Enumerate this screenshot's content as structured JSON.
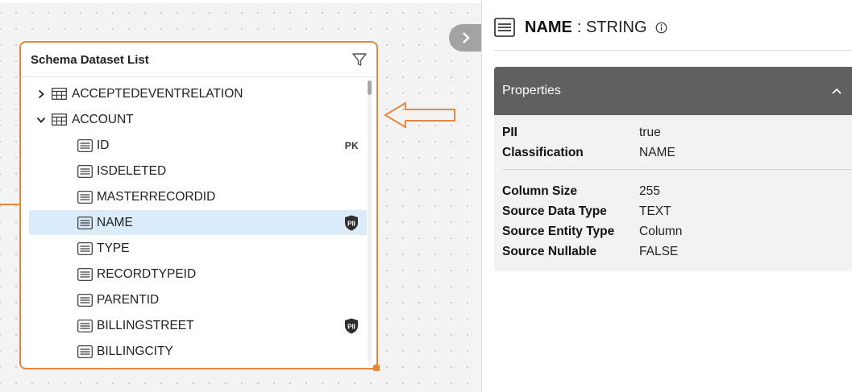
{
  "node": {
    "title": "Schema Dataset List",
    "rows": [
      {
        "label": "ACCEPTEDEVENTRELATION",
        "kind": "table",
        "expanded": false,
        "badge": ""
      },
      {
        "label": "ACCOUNT",
        "kind": "table",
        "expanded": true,
        "badge": ""
      },
      {
        "label": "ID",
        "kind": "column",
        "badge": "PK"
      },
      {
        "label": "ISDELETED",
        "kind": "column",
        "badge": ""
      },
      {
        "label": "MASTERRECORDID",
        "kind": "column",
        "badge": ""
      },
      {
        "label": "NAME",
        "kind": "column",
        "badge": "pii",
        "selected": true
      },
      {
        "label": "TYPE",
        "kind": "column",
        "badge": ""
      },
      {
        "label": "RECORDTYPEID",
        "kind": "column",
        "badge": ""
      },
      {
        "label": "PARENTID",
        "kind": "column",
        "badge": ""
      },
      {
        "label": "BILLINGSTREET",
        "kind": "column",
        "badge": "pii"
      },
      {
        "label": "BILLINGCITY",
        "kind": "column",
        "badge": ""
      }
    ],
    "pk_label": "PK",
    "pii_label": "PII"
  },
  "panel": {
    "field_name": "NAME",
    "field_type": ": STRING",
    "properties_title": "Properties",
    "group1": [
      {
        "key": "PII",
        "value": "true"
      },
      {
        "key": "Classification",
        "value": "NAME"
      }
    ],
    "group2": [
      {
        "key": "Column Size",
        "value": "255"
      },
      {
        "key": "Source Data Type",
        "value": "TEXT"
      },
      {
        "key": "Source Entity Type",
        "value": "Column"
      },
      {
        "key": "Source Nullable",
        "value": "FALSE"
      }
    ]
  },
  "colors": {
    "accent": "#e8863a",
    "selected_row": "#dcebf9",
    "properties_header": "#606060",
    "toggle": "#a3a3a3"
  },
  "icons": {
    "filter": "filter-icon",
    "table": "table-icon",
    "column": "column-icon",
    "pii": "pii-shield-icon",
    "info": "info-icon",
    "chevron_right": "chevron-right-icon",
    "chevron_down": "chevron-down-icon",
    "chevron_up": "chevron-up-icon"
  }
}
